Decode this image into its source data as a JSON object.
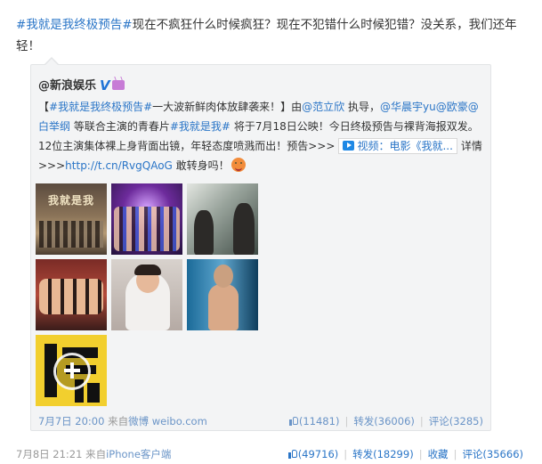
{
  "post": {
    "topic": "#我就是我终极预告#",
    "text": "现在不疯狂什么时候疯狂？现在不犯错什么时候犯错？没关系，我们还年轻！"
  },
  "repost": {
    "author": "@新浪娱乐",
    "verified": "V",
    "text": {
      "open_bracket": "【",
      "topic1": "#我就是我终极预告#",
      "p1": "一大波新鲜肉体放肆袭来！】由",
      "mention1": "@范立欣",
      "p2": "执导，",
      "mention2": "@华晨宇yu",
      "mention3": "@欧豪",
      "mention4": "@白举纲",
      "p3": "等联合主演的青春片",
      "topic2": "#我就是我#",
      "p4": "将于7月18日公映！今日终极预告与裸背海报双发。12位主演集体裸上身背面出镜，年轻态度喷溅而出！预告>>>",
      "video_label": "视频：电影《我就...",
      "details": "详情",
      "p5": ">>>",
      "short_link": "http://t.cn/RvgQAoG",
      "p6": "敢转身吗！"
    },
    "images": [
      {
        "icon": "poster-image",
        "caption": "我就是我"
      },
      {
        "icon": "group-photo-image"
      },
      {
        "icon": "gym-photo-image"
      },
      {
        "icon": "friends-photo-image"
      },
      {
        "icon": "portrait-image"
      },
      {
        "icon": "pool-photo-image"
      },
      {
        "icon": "video-thumbnail-image"
      }
    ],
    "meta": {
      "time": "7月7日 20:00",
      "from_label": "来自",
      "source": "微博 weibo.com",
      "like_count": "(11481)",
      "repost_label": "转发(36006)",
      "comment_label": "评论(3285)"
    }
  },
  "footer": {
    "time": "7月8日 21:21",
    "from_label": "来自",
    "source": "iPhone客户端",
    "like_count": "(49716)",
    "repost_label": "转发(18299)",
    "favorite_label": "收藏",
    "comment_label": "评论(35666)"
  },
  "colors": {
    "link": "#2a75c7",
    "muted": "#999999",
    "repost_bg": "#f3f4f5"
  }
}
